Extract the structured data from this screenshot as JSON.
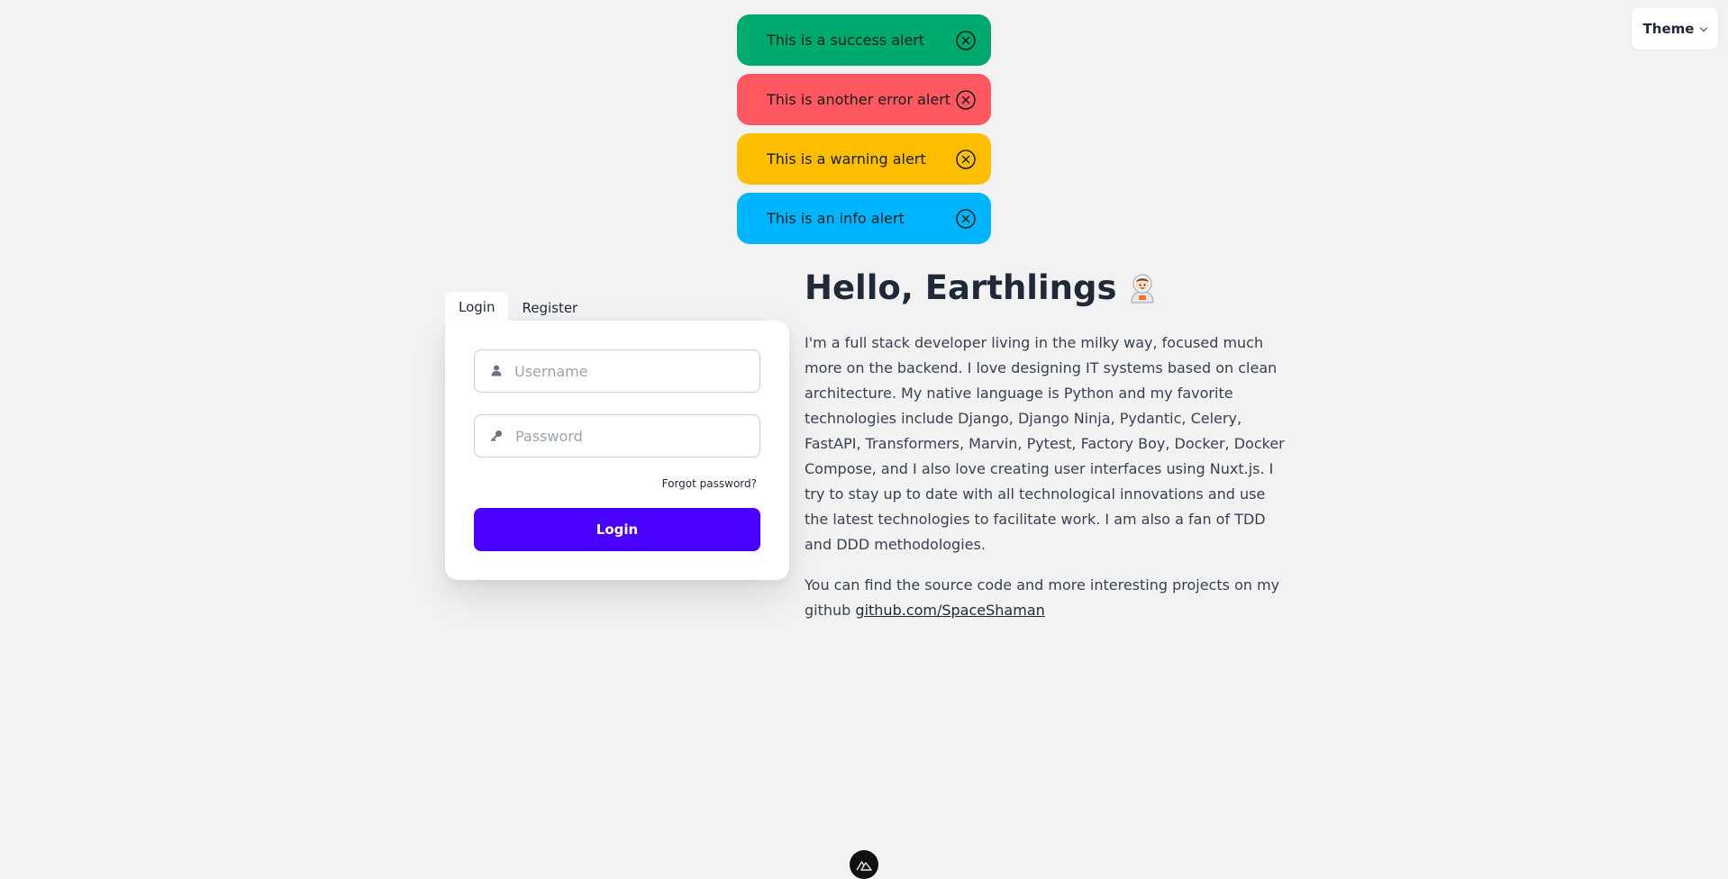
{
  "header": {
    "theme_label": "Theme"
  },
  "alerts": [
    {
      "type": "success",
      "text": "This is a success alert",
      "color": "#00a96e"
    },
    {
      "type": "error",
      "text": "This is another error alert",
      "color": "#ff5861"
    },
    {
      "type": "warning",
      "text": "This is a warning alert",
      "color": "#ffbe00"
    },
    {
      "type": "info",
      "text": "This is an info alert",
      "color": "#00b5ff"
    }
  ],
  "auth": {
    "tabs": [
      "Login",
      "Register"
    ],
    "active_tab": "Login",
    "username_placeholder": "Username",
    "password_placeholder": "Password",
    "forgot_label": "Forgot password?",
    "submit_label": "Login",
    "accent_color": "#4a00ff"
  },
  "intro": {
    "title": "Hello, Earthlings",
    "title_emoji_icon": "astronaut-icon",
    "bio": "I'm a full stack developer living in the milky way, focused much more on the backend. I love designing IT systems based on clean architecture. My native language is Python and my favorite technologies include Django, Django Ninja, Pydantic, Celery, FastAPI, Transformers, Marvin, Pytest, Factory Boy, Docker, Docker Compose, and I also love creating user interfaces using Nuxt.js. I try to stay up to date with all technological innovations and use the latest technologies to facilitate work. I am also a fan of TDD and DDD methodologies.",
    "source_text": "You can find the source code and more interesting projects on my github ",
    "github_link": "github.com/SpaceShaman"
  },
  "footer": {
    "badge_icon": "nuxt-icon"
  }
}
